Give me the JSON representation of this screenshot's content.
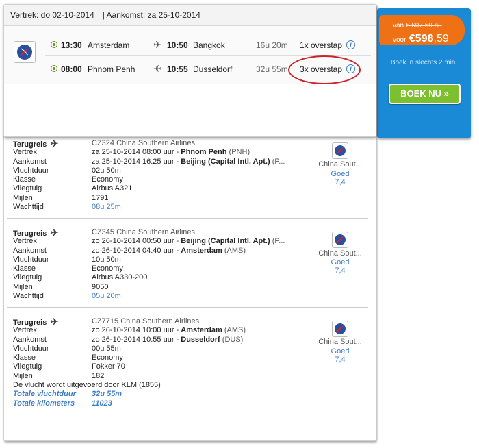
{
  "header": {
    "departure_label": "Vertrek: do 02-10-2014",
    "arrival_label": "| Aankomst: za 25-10-2014"
  },
  "legs": [
    {
      "dep_time": "13:30",
      "dep_city": "Amsterdam",
      "arr_time": "10:50",
      "arr_city": "Bangkok",
      "duration": "16u 20m",
      "stops": "1x overstap"
    },
    {
      "dep_time": "08:00",
      "dep_city": "Phnom Penh",
      "arr_time": "10:55",
      "arr_city": "Dusseldorf",
      "duration": "32u 55m",
      "stops": "3x overstap"
    }
  ],
  "price_box": {
    "van_label": "van",
    "old_price": "€ 607,59 nu",
    "voor_label": "voor",
    "new_price": "€598",
    "new_cents": ",59",
    "boek_info": "Boek in slechts 2 min.",
    "boek_button": "BOEK NU »"
  },
  "segments": [
    {
      "title": "Terugreis",
      "flight": "CZ324 China Southern Airlines",
      "rows": [
        {
          "label": "Vertrek",
          "value_pre": "za 25-10-2014 08:00 uur - ",
          "value_bold": "Phnom Penh",
          "value_post": " (PNH)"
        },
        {
          "label": "Aankomst",
          "value_pre": "za 25-10-2014 16:25 uur - ",
          "value_bold": "Beijing (Capital Intl. Apt.)",
          "value_post": " (P..."
        },
        {
          "label": "Vluchtduur",
          "value_pre": "02u 50m"
        },
        {
          "label": "Klasse",
          "value_pre": "Economy"
        },
        {
          "label": "Vliegtuig",
          "value_pre": "Airbus A321"
        },
        {
          "label": "Mijlen",
          "value_pre": "1791"
        }
      ],
      "wait_label": "Wachttijd",
      "wait_value": "08u 25m",
      "airline": "China Sout...",
      "rating_word": "Goed",
      "rating": "7,4"
    },
    {
      "title": "Terugreis",
      "flight": "CZ345 China Southern Airlines",
      "rows": [
        {
          "label": "Vertrek",
          "value_pre": "zo 26-10-2014 00:50 uur - ",
          "value_bold": "Beijing (Capital Intl. Apt.)",
          "value_post": " (P..."
        },
        {
          "label": "Aankomst",
          "value_pre": "zo 26-10-2014 04:40 uur - ",
          "value_bold": "Amsterdam",
          "value_post": " (AMS)"
        },
        {
          "label": "Vluchtduur",
          "value_pre": "10u 50m"
        },
        {
          "label": "Klasse",
          "value_pre": "Economy"
        },
        {
          "label": "Vliegtuig",
          "value_pre": "Airbus A330-200"
        },
        {
          "label": "Mijlen",
          "value_pre": "9050"
        }
      ],
      "wait_label": "Wachttijd",
      "wait_value": "05u 20m",
      "airline": "China Sout...",
      "rating_word": "Goed",
      "rating": "7,4"
    },
    {
      "title": "Terugreis",
      "flight": "CZ7715 China Southern Airlines",
      "rows": [
        {
          "label": "Vertrek",
          "value_pre": "zo 26-10-2014 10:00 uur - ",
          "value_bold": "Amsterdam",
          "value_post": " (AMS)"
        },
        {
          "label": "Aankomst",
          "value_pre": "zo 26-10-2014 10:55 uur - ",
          "value_bold": "Dusseldorf",
          "value_post": " (DUS)"
        },
        {
          "label": "Vluchtduur",
          "value_pre": "00u 55m"
        },
        {
          "label": "Klasse",
          "value_pre": "Economy"
        },
        {
          "label": "Vliegtuig",
          "value_pre": "Fokker 70"
        },
        {
          "label": "Mijlen",
          "value_pre": "182"
        }
      ],
      "operated_by": "De vlucht wordt uitgevoerd door KLM (1855)",
      "airline": "China Sout...",
      "rating_word": "Goed",
      "rating": "7,4"
    }
  ],
  "totals": {
    "duration_label": "Totale vluchtduur",
    "duration_value": "32u 55m",
    "km_label": "Totale kilometers",
    "km_value": "11023"
  },
  "colors": {
    "accent_blue": "#1b8ad6",
    "price_orange": "#ef7116",
    "button_green": "#7cbf2f",
    "highlight_red": "#c8262b"
  }
}
